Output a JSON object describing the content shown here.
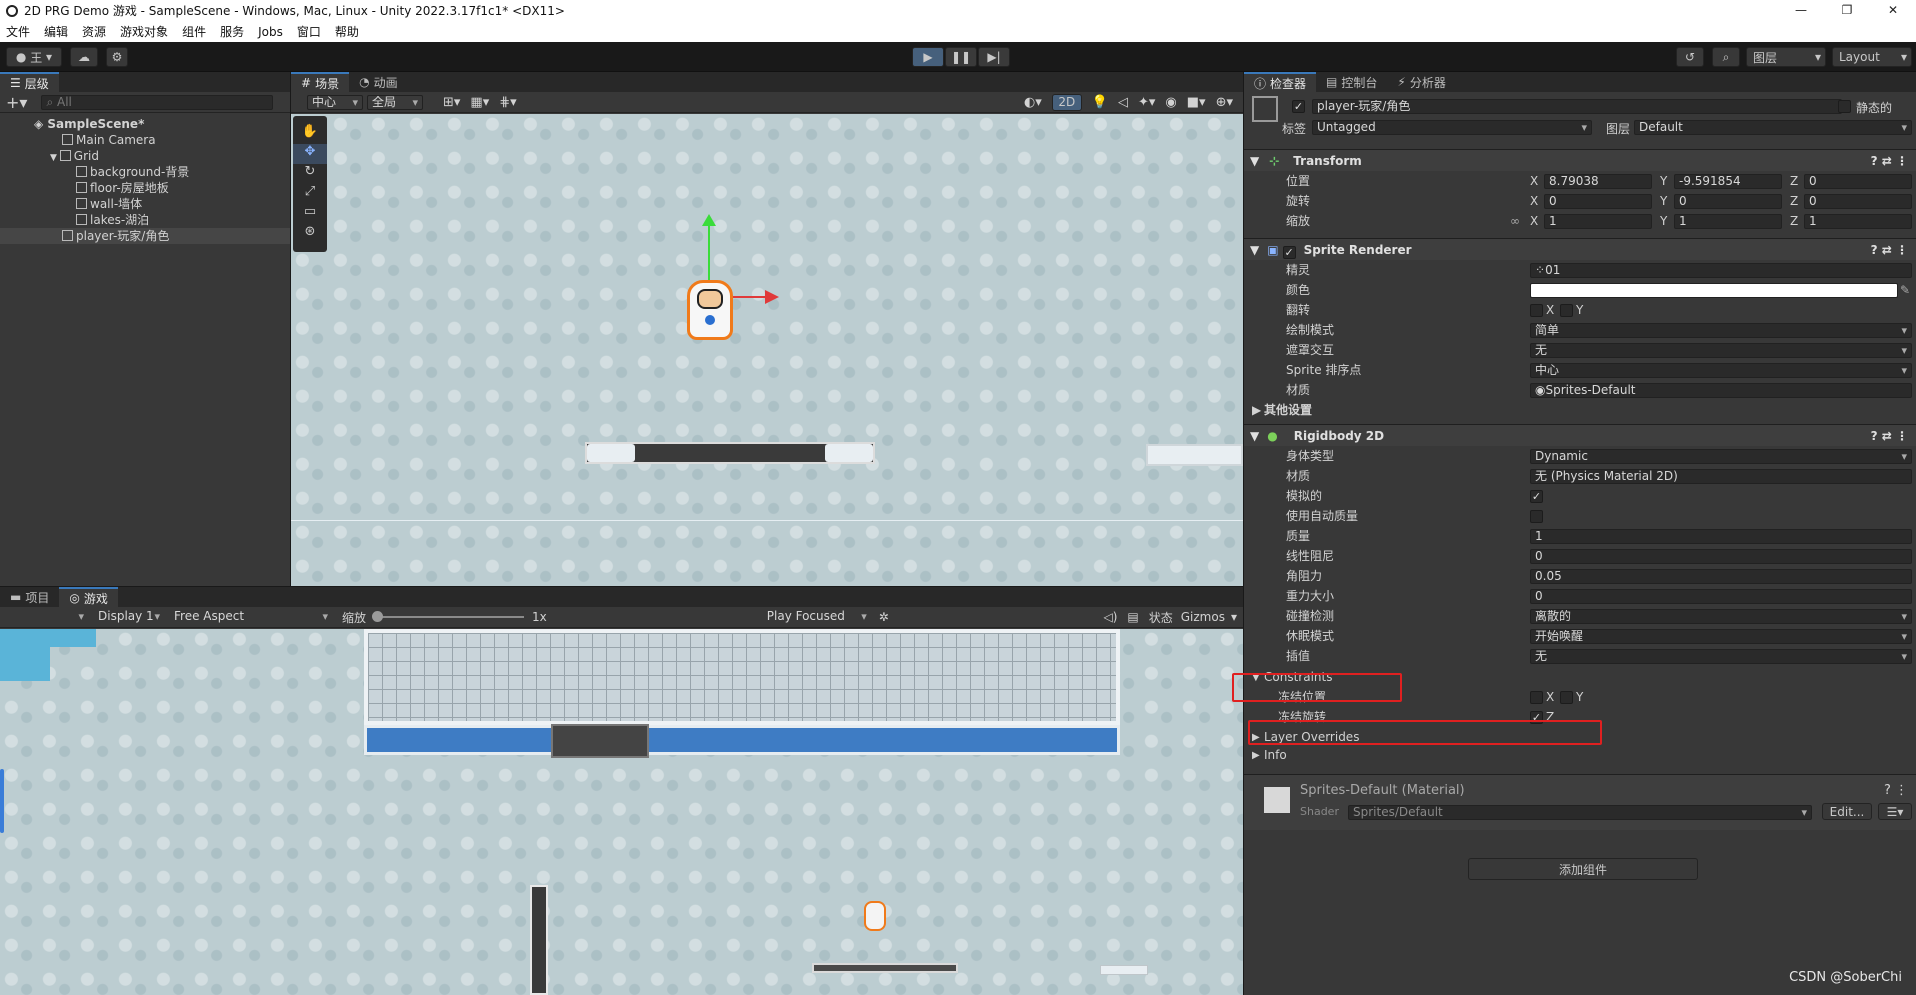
{
  "window": {
    "title": "2D PRG Demo 游戏 - SampleScene - Windows, Mac, Linux - Unity 2022.3.17f1c1* <DX11>",
    "min": "—",
    "max": "❐",
    "close": "✕"
  },
  "menu": [
    "文件",
    "编辑",
    "资源",
    "游戏对象",
    "组件",
    "服务",
    "Jobs",
    "窗口",
    "帮助"
  ],
  "toolbar": {
    "account": "王",
    "layers": "图层",
    "layout": "Layout"
  },
  "hierarchy": {
    "tab": "层级",
    "search_placeholder": "All",
    "items": [
      {
        "label": "SampleScene*"
      },
      {
        "label": "Main Camera"
      },
      {
        "label": "Grid"
      },
      {
        "label": "background-背景"
      },
      {
        "label": "floor-房屋地板"
      },
      {
        "label": "wall-墙体"
      },
      {
        "label": "lakes-湖泊"
      },
      {
        "label": "player-玩家/角色"
      }
    ]
  },
  "scene": {
    "tabs": [
      "场景",
      "动画"
    ],
    "pivot": "中心",
    "space": "全局",
    "mode_2d": "2D"
  },
  "game": {
    "tabs": [
      "项目",
      "游戏"
    ],
    "display": "Display 1",
    "aspect": "Free Aspect",
    "scale_label": "缩放",
    "scale_value": "1x",
    "play_mode": "Play Focused",
    "stats": "状态",
    "gizmos": "Gizmos"
  },
  "inspector": {
    "tabs": [
      "检查器",
      "控制台",
      "分析器"
    ],
    "object_name": "player-玩家/角色",
    "static_label": "静态的",
    "tag_label": "标签",
    "tag_value": "Untagged",
    "layer_label": "图层",
    "layer_value": "Default",
    "transform": {
      "title": "Transform",
      "position_label": "位置",
      "rotation_label": "旋转",
      "scale_label": "缩放",
      "pos": [
        "8.79038",
        "-9.591854",
        "0"
      ],
      "rot": [
        "0",
        "0",
        "0"
      ],
      "scl": [
        "1",
        "1",
        "1"
      ]
    },
    "sprite_renderer": {
      "title": "Sprite Renderer",
      "sprite_label": "精灵",
      "sprite_value": "01",
      "color_label": "颜色",
      "flip_label": "翻转",
      "draw_mode_label": "绘制模式",
      "draw_mode_value": "简单",
      "mask_label": "遮罩交互",
      "mask_value": "无",
      "sort_point_label": "Sprite 排序点",
      "sort_point_value": "中心",
      "material_label": "材质",
      "material_value": "Sprites-Default",
      "other_label": "其他设置"
    },
    "rigidbody": {
      "title": "Rigidbody 2D",
      "body_type_label": "身体类型",
      "body_type_value": "Dynamic",
      "material_label": "材质",
      "material_value": "无 (Physics Material 2D)",
      "simulated_label": "模拟的",
      "auto_mass_label": "使用自动质量",
      "mass_label": "质量",
      "mass_value": "1",
      "linear_drag_label": "线性阻尼",
      "linear_drag_value": "0",
      "angular_drag_label": "角阻力",
      "angular_drag_value": "0.05",
      "gravity_label": "重力大小",
      "gravity_value": "0",
      "collision_label": "碰撞检测",
      "collision_value": "离散的",
      "sleep_label": "休眠模式",
      "sleep_value": "开始唤醒",
      "interp_label": "插值",
      "interp_value": "无",
      "constraints_label": "Constraints",
      "freeze_pos_label": "冻结位置",
      "freeze_rot_label": "冻结旋转",
      "layer_overrides_label": "Layer Overrides",
      "info_label": "Info"
    },
    "material": {
      "title": "Sprites-Default (Material)",
      "shader_label": "Shader",
      "shader_value": "Sprites/Default",
      "edit_label": "Edit..."
    },
    "add_component": "添加组件",
    "axis": {
      "x": "X",
      "y": "Y",
      "z": "Z"
    },
    "check": "✓"
  },
  "watermark": "CSDN @SoberChi"
}
